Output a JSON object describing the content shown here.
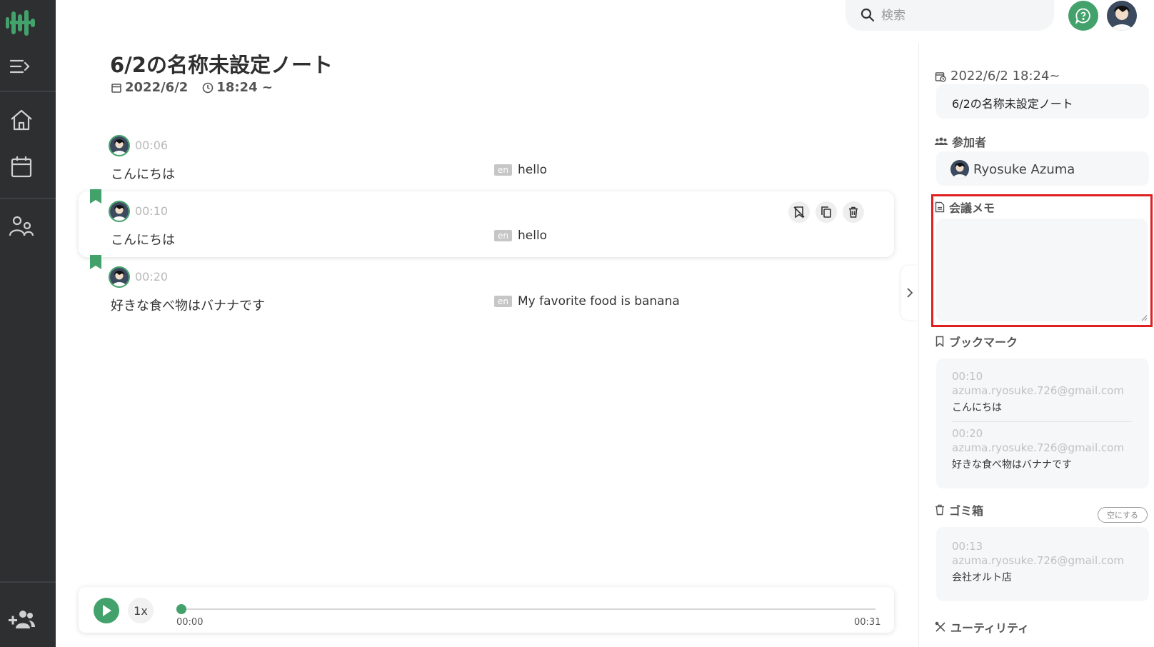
{
  "app": {
    "brand_color": "#43a26b",
    "sidebar_bg": "#2d2f31",
    "logo_icon": "waveform-logo-icon"
  },
  "sidebar": {
    "items": [
      {
        "name": "menu-toggle",
        "icon": "menu-expand-icon"
      },
      {
        "name": "home",
        "icon": "home-icon"
      },
      {
        "name": "calendar",
        "icon": "calendar-icon"
      },
      {
        "name": "people",
        "icon": "people-icon"
      },
      {
        "name": "add-user",
        "icon": "add-user-icon"
      }
    ]
  },
  "header": {
    "search_placeholder": "検索",
    "help_icon": "chat-help-icon"
  },
  "note": {
    "title": "6/2の名称未設定ノート",
    "date": "2022/6/2",
    "time": "18:24 ~"
  },
  "transcript": [
    {
      "time": "00:06",
      "text": "こんにちは",
      "lang": "en",
      "translation": "hello",
      "bookmarked": false
    },
    {
      "time": "00:10",
      "text": "こんにちは",
      "lang": "en",
      "translation": "hello",
      "bookmarked": true
    },
    {
      "time": "00:20",
      "text": "好きな食べ物はバナナです",
      "lang": "en",
      "translation": "My favorite food is banana",
      "bookmarked": true
    }
  ],
  "player": {
    "speed": "1x",
    "current": "00:00",
    "duration": "00:31",
    "progress": 0
  },
  "panel": {
    "datetime": "2022/6/2 18:24~",
    "title_value": "6/2の名称未設定ノート",
    "participants_label": "参加者",
    "participant_name": "Ryosuke Azuma",
    "memo_label": "会議メモ",
    "memo_value": "",
    "bookmarks_label": "ブックマーク",
    "bookmarks": [
      {
        "time": "00:10",
        "email": "azuma.ryosuke.726@gmail.com",
        "text": "こんにちは"
      },
      {
        "time": "00:20",
        "email": "azuma.ryosuke.726@gmail.com",
        "text": "好きな食べ物はバナナです"
      }
    ],
    "trash_label": "ゴミ箱",
    "empty_button": "空にする",
    "trash": [
      {
        "time": "00:13",
        "email": "azuma.ryosuke.726@gmail.com",
        "text": "会社オルト店"
      }
    ],
    "utility_label": "ユーティリティ"
  }
}
